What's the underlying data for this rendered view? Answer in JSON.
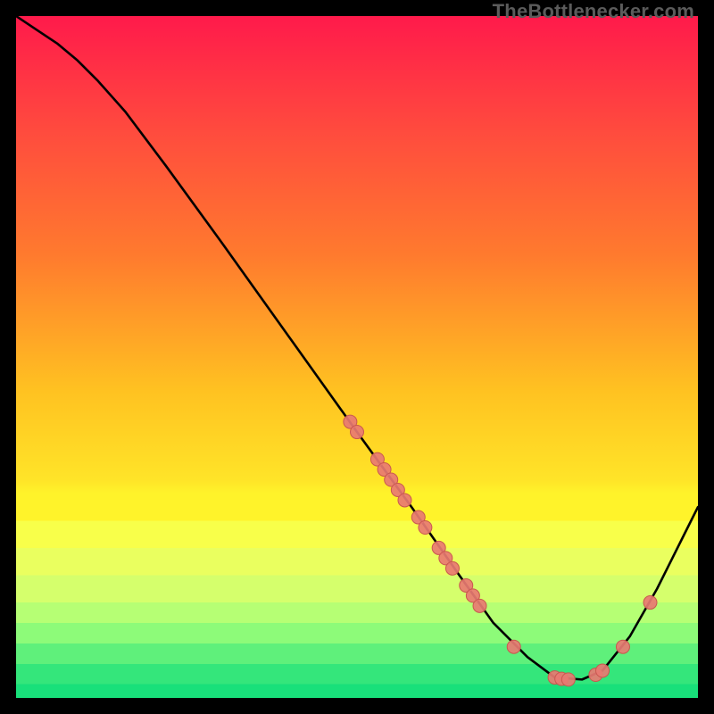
{
  "watermark": "TheBottlenecker.com",
  "colors": {
    "gradient_top": "#ff1a4b",
    "gradient_mid_upper": "#ff7a2e",
    "gradient_mid": "#ffe428",
    "gradient_lower": "#f2ff55",
    "gradient_bottom": "#18e07a",
    "curve": "#000000",
    "marker_fill": "#e87a72",
    "marker_stroke": "#c9584f"
  },
  "chart_data": {
    "type": "line",
    "title": "",
    "xlabel": "",
    "ylabel": "",
    "xlim": [
      0,
      100
    ],
    "ylim": [
      0,
      100
    ],
    "curve": [
      {
        "x": 0,
        "y": 100
      },
      {
        "x": 3,
        "y": 98
      },
      {
        "x": 6,
        "y": 96
      },
      {
        "x": 9,
        "y": 93.5
      },
      {
        "x": 12,
        "y": 90.5
      },
      {
        "x": 16,
        "y": 86
      },
      {
        "x": 22,
        "y": 78
      },
      {
        "x": 30,
        "y": 67
      },
      {
        "x": 40,
        "y": 53
      },
      {
        "x": 50,
        "y": 39
      },
      {
        "x": 58,
        "y": 28
      },
      {
        "x": 65,
        "y": 18
      },
      {
        "x": 70,
        "y": 11
      },
      {
        "x": 75,
        "y": 6
      },
      {
        "x": 79,
        "y": 3
      },
      {
        "x": 83,
        "y": 2.7
      },
      {
        "x": 86,
        "y": 4
      },
      {
        "x": 90,
        "y": 9
      },
      {
        "x": 94,
        "y": 16
      },
      {
        "x": 98,
        "y": 24
      },
      {
        "x": 100,
        "y": 28
      }
    ],
    "markers": [
      {
        "x": 49,
        "y": 40.5
      },
      {
        "x": 50,
        "y": 39
      },
      {
        "x": 53,
        "y": 35
      },
      {
        "x": 54,
        "y": 33.5
      },
      {
        "x": 55,
        "y": 32
      },
      {
        "x": 56,
        "y": 30.5
      },
      {
        "x": 57,
        "y": 29
      },
      {
        "x": 59,
        "y": 26.5
      },
      {
        "x": 60,
        "y": 25
      },
      {
        "x": 62,
        "y": 22
      },
      {
        "x": 63,
        "y": 20.5
      },
      {
        "x": 64,
        "y": 19
      },
      {
        "x": 66,
        "y": 16.5
      },
      {
        "x": 67,
        "y": 15
      },
      {
        "x": 68,
        "y": 13.5
      },
      {
        "x": 73,
        "y": 7.5
      },
      {
        "x": 79,
        "y": 3
      },
      {
        "x": 80,
        "y": 2.8
      },
      {
        "x": 81,
        "y": 2.7
      },
      {
        "x": 85,
        "y": 3.4
      },
      {
        "x": 86,
        "y": 4
      },
      {
        "x": 89,
        "y": 7.5
      },
      {
        "x": 93,
        "y": 14
      }
    ]
  }
}
